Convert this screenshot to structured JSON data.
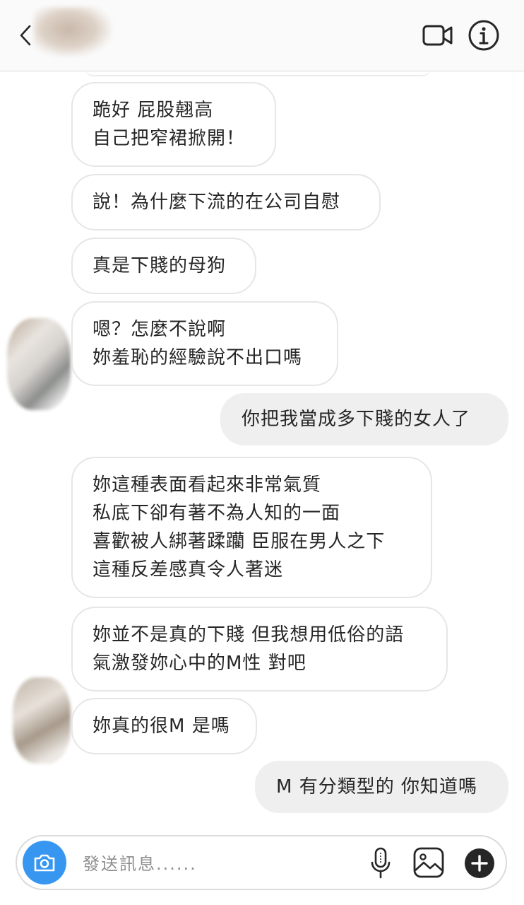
{
  "composer": {
    "placeholder": "發送訊息......"
  },
  "messages": [
    {
      "direction": "in",
      "text": "跪好 屁股翹高\n自己把窄裙掀開！"
    },
    {
      "direction": "in",
      "text": "說！為什麼下流的在公司自慰"
    },
    {
      "direction": "in",
      "text": "真是下賤的母狗"
    },
    {
      "direction": "in",
      "text": "嗯？怎麼不說啊\n妳羞恥的經驗說不出口嗎"
    },
    {
      "direction": "out",
      "text": "你把我當成多下賤的女人了"
    },
    {
      "direction": "in",
      "text": "妳這種表面看起來非常氣質\n私底下卻有著不為人知的一面\n喜歡被人綁著蹂躪 臣服在男人之下\n這種反差感真令人著迷"
    },
    {
      "direction": "in",
      "text": "妳並不是真的下賤 但我想用低俗的語\n氣激發妳心中的M性 對吧"
    },
    {
      "direction": "in",
      "text": "妳真的很M 是嗎"
    },
    {
      "direction": "out",
      "text": "M 有分類型的 你知道嗎"
    }
  ],
  "colors": {
    "accent": "#3797f0",
    "outgoing_bubble": "#efefef",
    "incoming_border": "#e6e6e6"
  }
}
